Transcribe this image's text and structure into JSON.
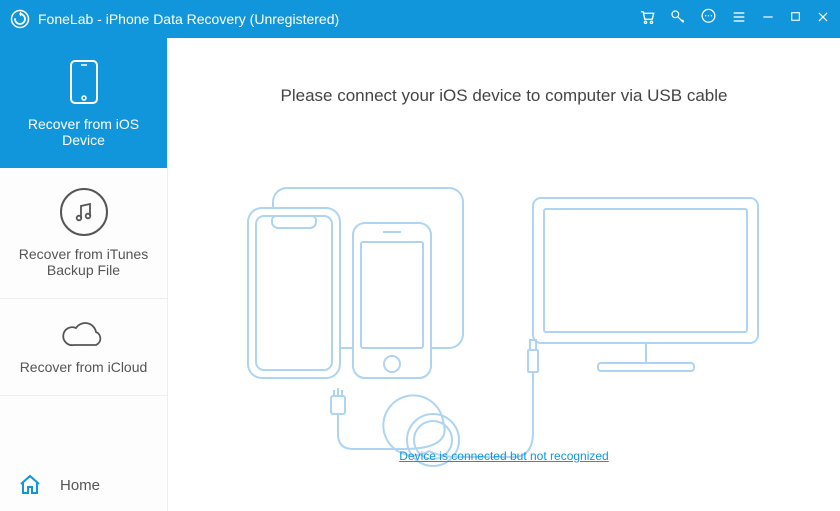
{
  "colors": {
    "primary": "#1296db",
    "stroke": "#aed4f4"
  },
  "titlebar": {
    "title": "FoneLab - iPhone Data Recovery (Unregistered)",
    "icons": {
      "cart": "cart-icon",
      "key": "key-icon",
      "feedback": "feedback-icon",
      "menu": "menu-icon",
      "min": "minimize-icon",
      "max": "maximize-icon",
      "close": "close-icon"
    }
  },
  "sidebar": {
    "items": [
      {
        "label": "Recover from iOS Device",
        "icon": "phone-icon",
        "active": true
      },
      {
        "label": "Recover from iTunes Backup File",
        "icon": "itunes-icon",
        "active": false
      },
      {
        "label": "Recover from iCloud",
        "icon": "cloud-icon",
        "active": false
      }
    ],
    "home_label": "Home"
  },
  "main": {
    "instruction": "Please connect your iOS device to computer via USB cable",
    "not_recognized_link": "Device is connected but not recognized"
  }
}
